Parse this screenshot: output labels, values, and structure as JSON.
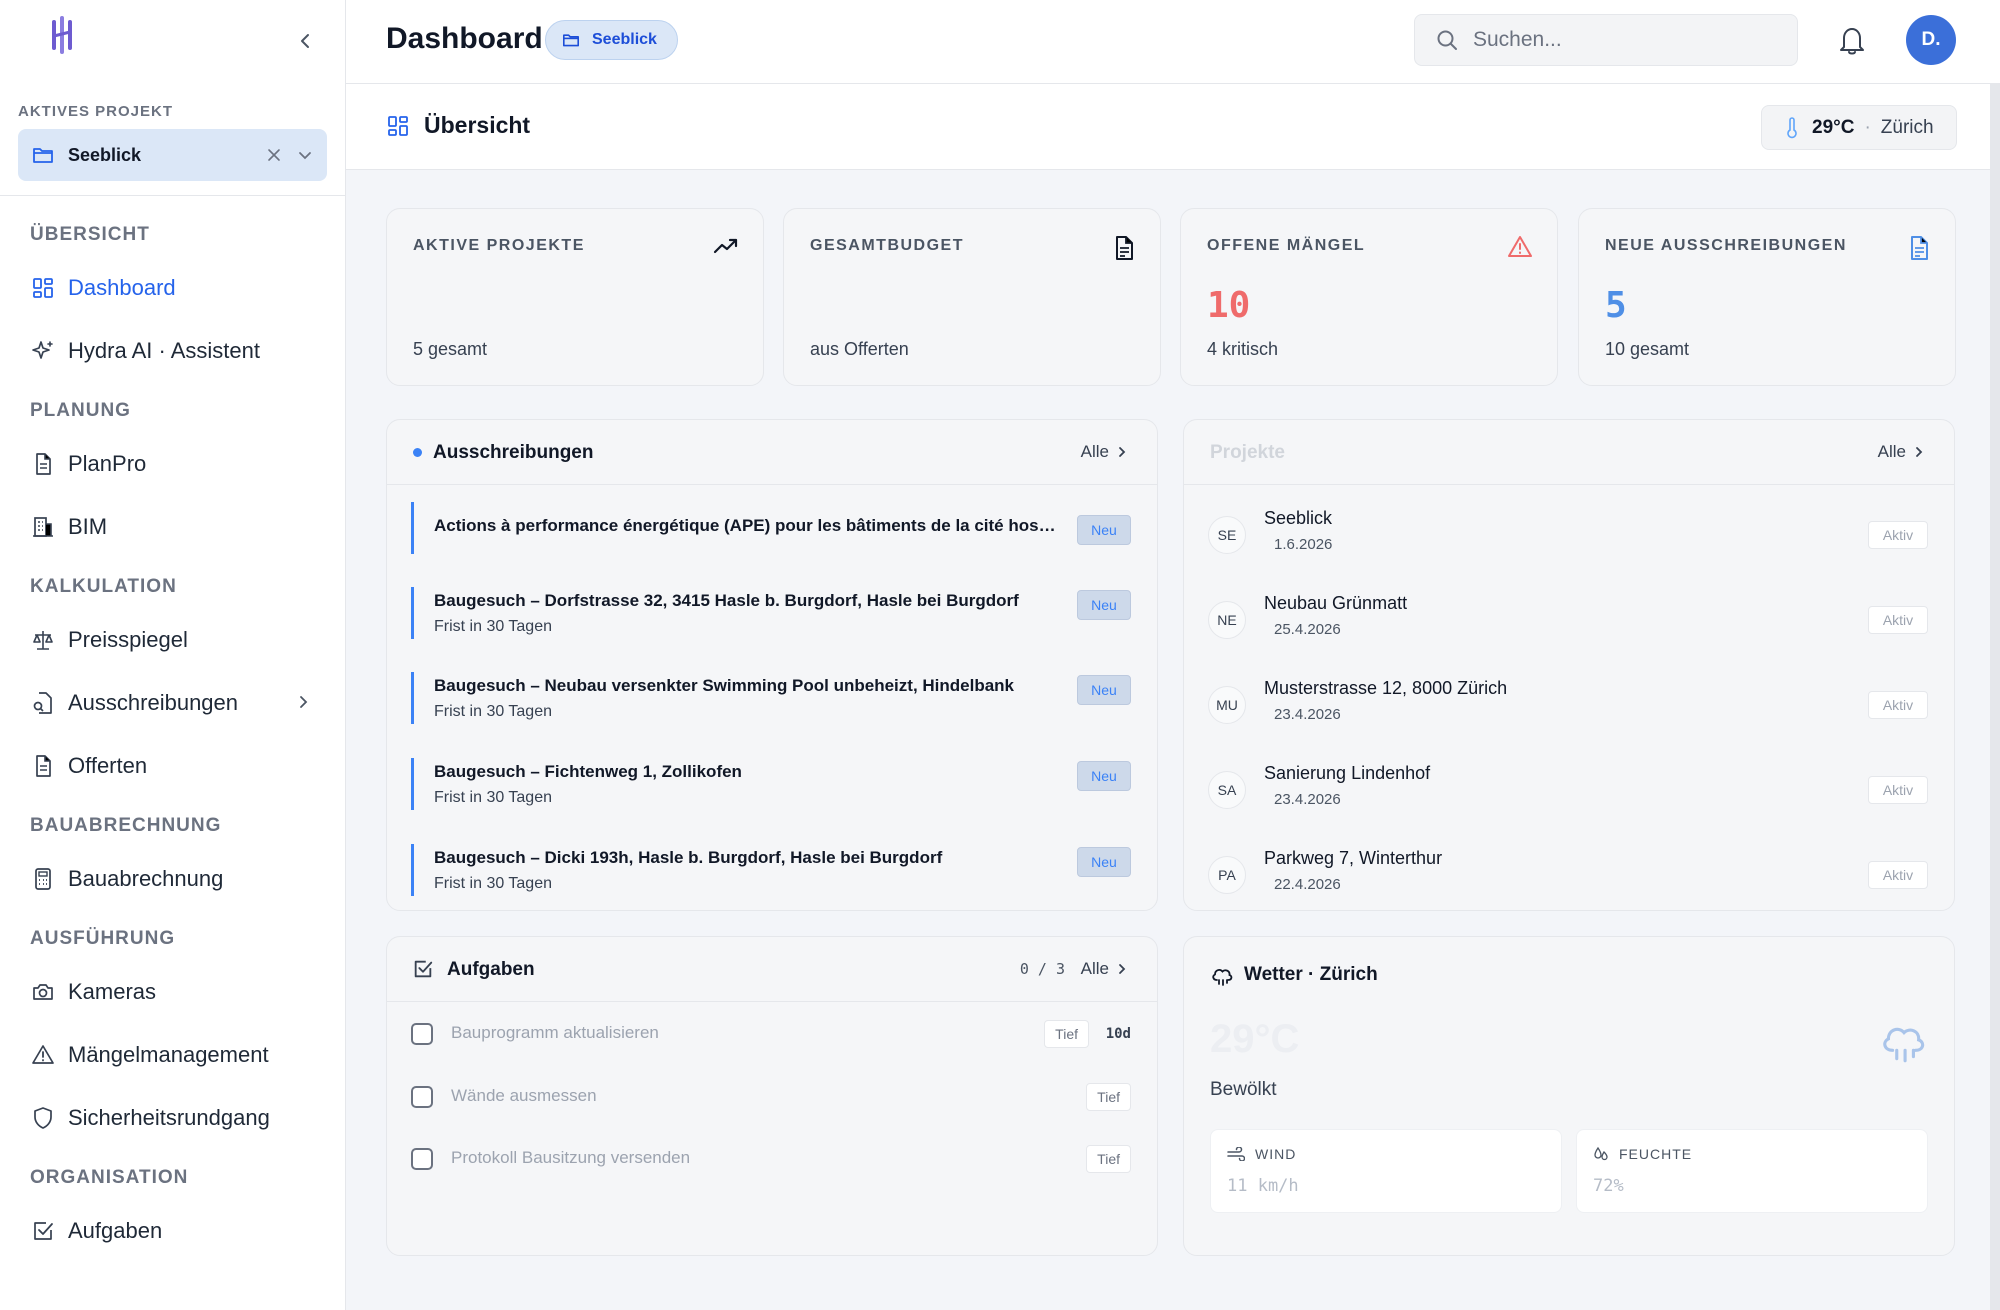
{
  "sidebar": {
    "active_project_label": "AKTIVES PROJEKT",
    "active_project_name": "Seeblick",
    "sections": [
      {
        "label": "ÜBERSICHT",
        "items": [
          {
            "label": "Dashboard",
            "icon": "dashboard-icon",
            "active": true
          },
          {
            "label": "Hydra AI · Assistent",
            "icon": "sparkle-icon"
          }
        ]
      },
      {
        "label": "PLANUNG",
        "items": [
          {
            "label": "PlanPro",
            "icon": "document-icon"
          },
          {
            "label": "BIM",
            "icon": "building-icon"
          }
        ]
      },
      {
        "label": "KALKULATION",
        "items": [
          {
            "label": "Preisspiegel",
            "icon": "scale-icon"
          },
          {
            "label": "Ausschreibungen",
            "icon": "file-search-icon",
            "has_submenu": true
          },
          {
            "label": "Offerten",
            "icon": "document-icon"
          }
        ]
      },
      {
        "label": "BAUABRECHNUNG",
        "items": [
          {
            "label": "Bauabrechnung",
            "icon": "calculator-icon"
          }
        ]
      },
      {
        "label": "AUSFÜHRUNG",
        "items": [
          {
            "label": "Kameras",
            "icon": "camera-icon"
          },
          {
            "label": "Mängelmanagement",
            "icon": "warning-icon"
          },
          {
            "label": "Sicherheitsrundgang",
            "icon": "shield-icon"
          }
        ]
      },
      {
        "label": "ORGANISATION",
        "items": [
          {
            "label": "Aufgaben",
            "icon": "checkbox-icon"
          }
        ]
      }
    ]
  },
  "header": {
    "title": "Dashboard",
    "project_badge": "Seeblick",
    "search_placeholder": "Suchen...",
    "avatar_initials": "D."
  },
  "subheader": {
    "title": "Übersicht",
    "temperature": "29°C",
    "separator": "·",
    "city": "Zürich"
  },
  "stats": [
    {
      "label": "AKTIVE PROJEKTE",
      "value": "",
      "sub": "5 gesamt",
      "icon": "trending-up-icon",
      "color": "#111827"
    },
    {
      "label": "GESAMTBUDGET",
      "value": "",
      "sub": "aus Offerten",
      "icon": "document-icon",
      "color": "#111827"
    },
    {
      "label": "OFFENE MÄNGEL",
      "value": "10",
      "sub": "4 kritisch",
      "icon": "warning-icon",
      "color": "#ef6b6b"
    },
    {
      "label": "NEUE AUSSCHREIBUNGEN",
      "value": "5",
      "sub": "10 gesamt",
      "icon": "document-icon",
      "color": "#4f8fe6"
    }
  ],
  "tenders": {
    "title": "Ausschreibungen",
    "all_label": "Alle",
    "items": [
      {
        "title": "Actions à performance énergétique (APE) pour les bâtiments de la cité hospitalière",
        "sub": "",
        "badge": "Neu"
      },
      {
        "title": "Baugesuch – Dorfstrasse 32, 3415 Hasle b. Burgdorf, Hasle bei Burgdorf",
        "sub": "Frist in 30 Tagen",
        "badge": "Neu"
      },
      {
        "title": "Baugesuch – Neubau versenkter Swimming Pool unbeheizt, Hindelbank",
        "sub": "Frist in 30 Tagen",
        "badge": "Neu"
      },
      {
        "title": "Baugesuch – Fichtenweg 1, Zollikofen",
        "sub": "Frist in 30 Tagen",
        "badge": "Neu"
      },
      {
        "title": "Baugesuch – Dicki 193h, Hasle b. Burgdorf, Hasle bei Burgdorf",
        "sub": "Frist in 30 Tagen",
        "badge": "Neu"
      }
    ]
  },
  "projects": {
    "title": "Projekte",
    "all_label": "Alle",
    "items": [
      {
        "initials": "SE",
        "name": "Seeblick",
        "date": "1.6.2026",
        "status": "Aktiv"
      },
      {
        "initials": "NE",
        "name": "Neubau Grünmatt",
        "date": "25.4.2026",
        "status": "Aktiv"
      },
      {
        "initials": "MU",
        "name": "Musterstrasse 12, 8000 Zürich",
        "date": "23.4.2026",
        "status": "Aktiv"
      },
      {
        "initials": "SA",
        "name": "Sanierung Lindenhof",
        "date": "23.4.2026",
        "status": "Aktiv"
      },
      {
        "initials": "PA",
        "name": "Parkweg 7, Winterthur",
        "date": "22.4.2026",
        "status": "Aktiv"
      }
    ]
  },
  "tasks": {
    "title": "Aufgaben",
    "count": "0 / 3",
    "all_label": "Alle",
    "items": [
      {
        "name": "Bauprogramm aktualisieren",
        "priority": "Tief",
        "due": "10d"
      },
      {
        "name": "Wände ausmessen",
        "priority": "Tief",
        "due": ""
      },
      {
        "name": "Protokoll Bausitzung versenden",
        "priority": "Tief",
        "due": ""
      }
    ]
  },
  "weather": {
    "title": "Wetter · Zürich",
    "temp": "29°C",
    "condition": "Bewölkt",
    "wind_label": "WIND",
    "wind_value": "11 km/h",
    "humidity_label": "FEUCHTE",
    "humidity_value": "72%"
  }
}
